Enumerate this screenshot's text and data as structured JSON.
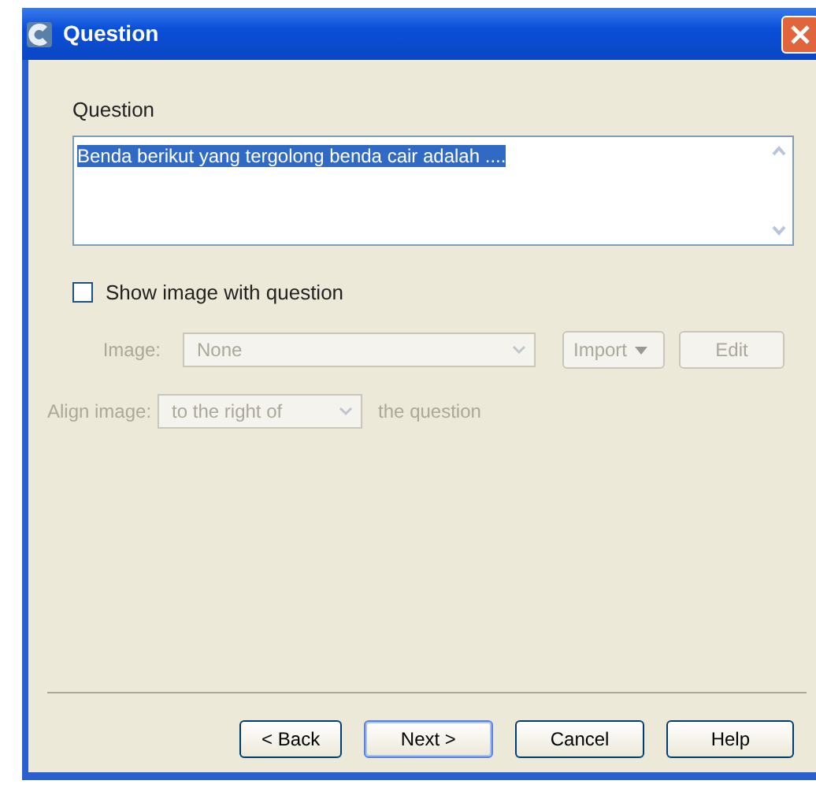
{
  "window": {
    "title": "Question"
  },
  "question": {
    "label": "Question",
    "value": "Benda berikut yang tergolong benda cair adalah ....",
    "selected": true
  },
  "show_image": {
    "label": "Show image with question",
    "checked": false
  },
  "image_row": {
    "label": "Image:",
    "value": "None",
    "import_label": "Import",
    "edit_label": "Edit",
    "disabled": true
  },
  "align_row": {
    "label": "Align image:",
    "value": "to the right of",
    "suffix": "the question",
    "disabled": true
  },
  "buttons": [
    {
      "label": "< Back",
      "default": false
    },
    {
      "label": "Next >",
      "default": true
    },
    {
      "label": "Cancel",
      "default": false
    },
    {
      "label": "Help",
      "default": false
    }
  ]
}
